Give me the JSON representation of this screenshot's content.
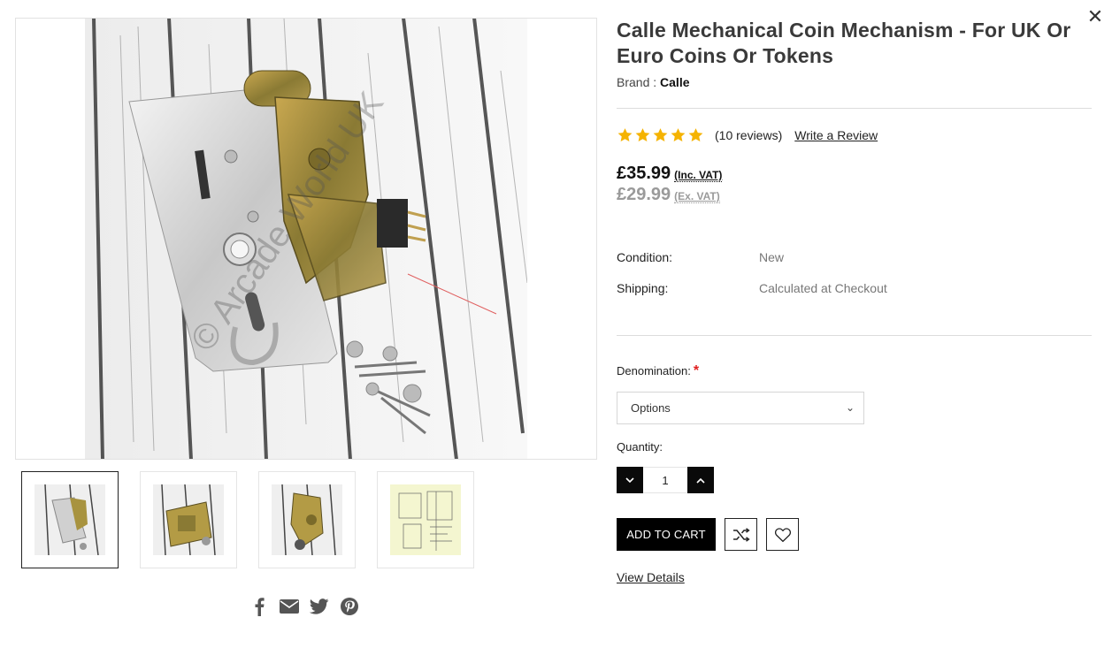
{
  "modal": {
    "close_icon": "close-icon"
  },
  "gallery": {
    "main_image_alt": "Calle Mechanical Coin Mechanism",
    "watermark": "© Arcade World UK",
    "thumbnails": [
      {
        "active": true
      },
      {
        "active": false
      },
      {
        "active": false
      },
      {
        "active": false
      }
    ],
    "share_icons": [
      "facebook-icon",
      "email-icon",
      "twitter-icon",
      "pinterest-icon"
    ]
  },
  "product": {
    "title": "Calle Mechanical Coin Mechanism - For UK Or Euro Coins Or Tokens",
    "brand_label": "Brand :",
    "brand_name": "Calle",
    "rating": {
      "stars": 5,
      "reviews_text": "(10 reviews)",
      "write_review": "Write a Review",
      "star_color": "#f5b301"
    },
    "price_inc": "£35.99",
    "price_inc_label": "(Inc. VAT)",
    "price_ex": "£29.99",
    "price_ex_label": "(Ex. VAT)",
    "specs": {
      "condition_label": "Condition:",
      "condition_value": "New",
      "shipping_label": "Shipping:",
      "shipping_value": "Calculated at Checkout"
    },
    "denomination_label": "Denomination:",
    "denomination_required": "*",
    "denomination_selected": "Options",
    "quantity_label": "Quantity:",
    "quantity_value": "1",
    "add_to_cart": "ADD TO CART",
    "view_details": "View Details"
  }
}
